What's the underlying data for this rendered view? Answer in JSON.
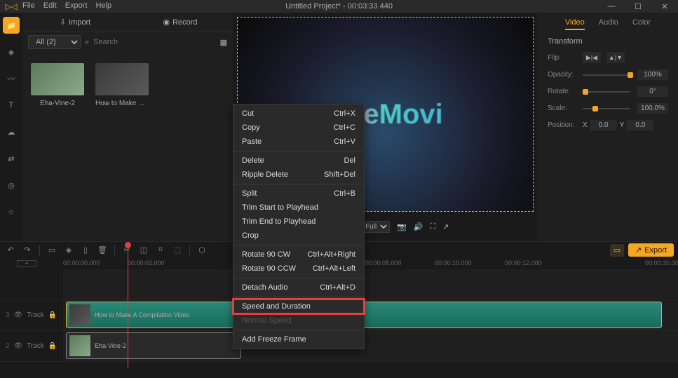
{
  "title": "Untitled Project* - 00:03:33.440",
  "menu": {
    "file": "File",
    "edit": "Edit",
    "export": "Export",
    "help": "Help"
  },
  "win": {
    "min": "—",
    "max": "☐",
    "close": "✕"
  },
  "mediaTabs": {
    "import": "Import",
    "record": "Record"
  },
  "mediaFilter": {
    "all": "All (2)",
    "searchPH": "Search"
  },
  "thumbs": {
    "t1": "Eha-Vine-2",
    "t2": "How to Make A ..."
  },
  "previewLogo": "AceMovi",
  "previewCtrl": {
    "full": "Full"
  },
  "props": {
    "tabs": {
      "video": "Video",
      "audio": "Audio",
      "color": "Color"
    },
    "section": "Transform",
    "flip": "Flip:",
    "opacity": "Opacity:",
    "opacityVal": "100%",
    "rotate": "Rotate:",
    "rotateVal": "0°",
    "scale": "Scale:",
    "scaleVal": "100.0%",
    "position": "Position:",
    "px": "X",
    "pxv": "0.0",
    "py": "Y",
    "pyv": "0.0"
  },
  "toolbar": {
    "export": "Export"
  },
  "ruler": [
    "00:00:00.000",
    "00:00:02.000",
    "00:00:08.000",
    "00:00:10.000",
    "00:00:12.000",
    "00:00:20.000"
  ],
  "tracks": {
    "t3": "3",
    "t3l": "Track",
    "t2": "2",
    "t2l": "Track",
    "clip1": "How to Make A Compilation Video",
    "clip2": "Eha-Vine-2"
  },
  "ctx": {
    "cut": "Cut",
    "cutk": "Ctrl+X",
    "copy": "Copy",
    "copyk": "Ctrl+C",
    "paste": "Paste",
    "pastek": "Ctrl+V",
    "del": "Delete",
    "delk": "Del",
    "rdel": "Ripple Delete",
    "rdelk": "Shift+Del",
    "split": "Split",
    "splitk": "Ctrl+B",
    "tstart": "Trim Start to Playhead",
    "tend": "Trim End to Playhead",
    "crop": "Crop",
    "rcw": "Rotate 90 CW",
    "rcwk": "Ctrl+Alt+Right",
    "rccw": "Rotate 90 CCW",
    "rccwk": "Ctrl+Alt+Left",
    "detach": "Detach Audio",
    "detachk": "Ctrl+Alt+D",
    "speed": "Speed and Duration",
    "normal": "Normal Speed",
    "freeze": "Add Freeze Frame"
  }
}
